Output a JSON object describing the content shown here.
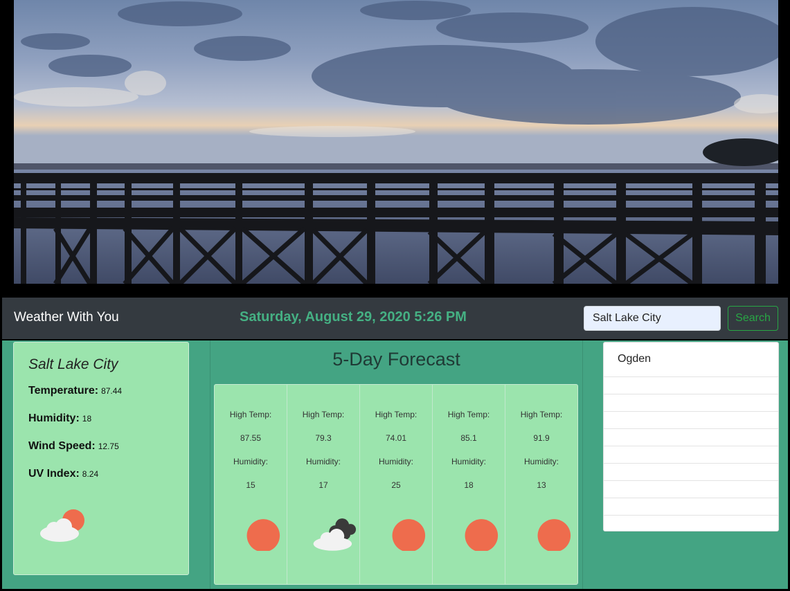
{
  "header": {
    "brand": "Weather With You",
    "datetime": "Saturday, August 29, 2020 5:26 PM"
  },
  "search": {
    "value": "Salt Lake City",
    "button_label": "Search"
  },
  "current": {
    "city": "Salt Lake City",
    "temperature_label": "Temperature:",
    "temperature": "87.44",
    "humidity_label": "Humidity:",
    "humidity": "18",
    "wind_label": "Wind Speed:",
    "wind": "12.75",
    "uv_label": "UV Index:",
    "uv": "8.24",
    "icon": "partly-cloudy-sun-icon"
  },
  "forecast": {
    "title": "5-Day Forecast",
    "high_label": "High Temp:",
    "humidity_label": "Humidity:",
    "days": [
      {
        "high": "87.55",
        "humidity": "15",
        "icon": "sun-icon"
      },
      {
        "high": "79.3",
        "humidity": "17",
        "icon": "dark-cloud-icon"
      },
      {
        "high": "74.01",
        "humidity": "25",
        "icon": "sun-icon"
      },
      {
        "high": "85.1",
        "humidity": "18",
        "icon": "sun-icon"
      },
      {
        "high": "91.9",
        "humidity": "13",
        "icon": "sun-icon"
      }
    ]
  },
  "history": {
    "items": [
      "Ogden",
      "",
      "",
      "",
      "",
      "",
      "",
      "",
      "",
      ""
    ]
  },
  "colors": {
    "navbar": "#343a40",
    "accent_green": "#45b083",
    "panel_green": "#9be4ad",
    "main_bg": "#44a483",
    "sun": "#ee6c4d",
    "search_outline": "#28a745"
  }
}
